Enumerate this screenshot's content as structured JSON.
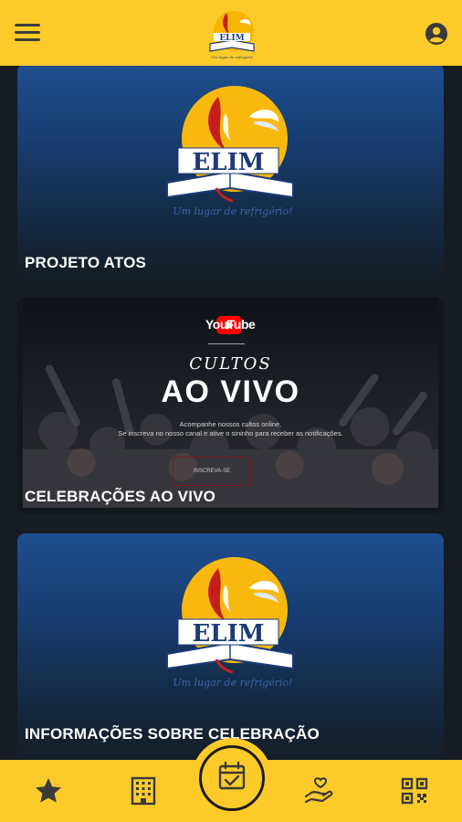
{
  "header": {
    "menu_icon": "hamburger-icon",
    "logo_icon": "elim-logo",
    "account_icon": "account-circle-icon"
  },
  "cards": [
    {
      "title": "PROJETO ATOS"
    },
    {
      "title": "CELEBRAÇÕES AO VIVO",
      "banner": {
        "platform": "YouTube",
        "kicker": "CULTOS",
        "headline": "AO VIVO",
        "description_line1": "Acompanhe nossos cultos online.",
        "description_line2": "Se inscreva no nosso canal e ative o sininho para receber as notificações.",
        "button_label": "INSCREVA-SE"
      }
    },
    {
      "title": "INFORMAÇÕES SOBRE CELEBRAÇÃO"
    }
  ],
  "bottom_nav": {
    "items": [
      "star-icon",
      "building-icon",
      "calendar-check-icon",
      "donation-hand-icon",
      "qr-code-icon"
    ],
    "active": "calendar-check-icon"
  },
  "colors": {
    "accent": "#fccb2a",
    "background": "#161c22",
    "card_blue": "#1e4f8f"
  }
}
